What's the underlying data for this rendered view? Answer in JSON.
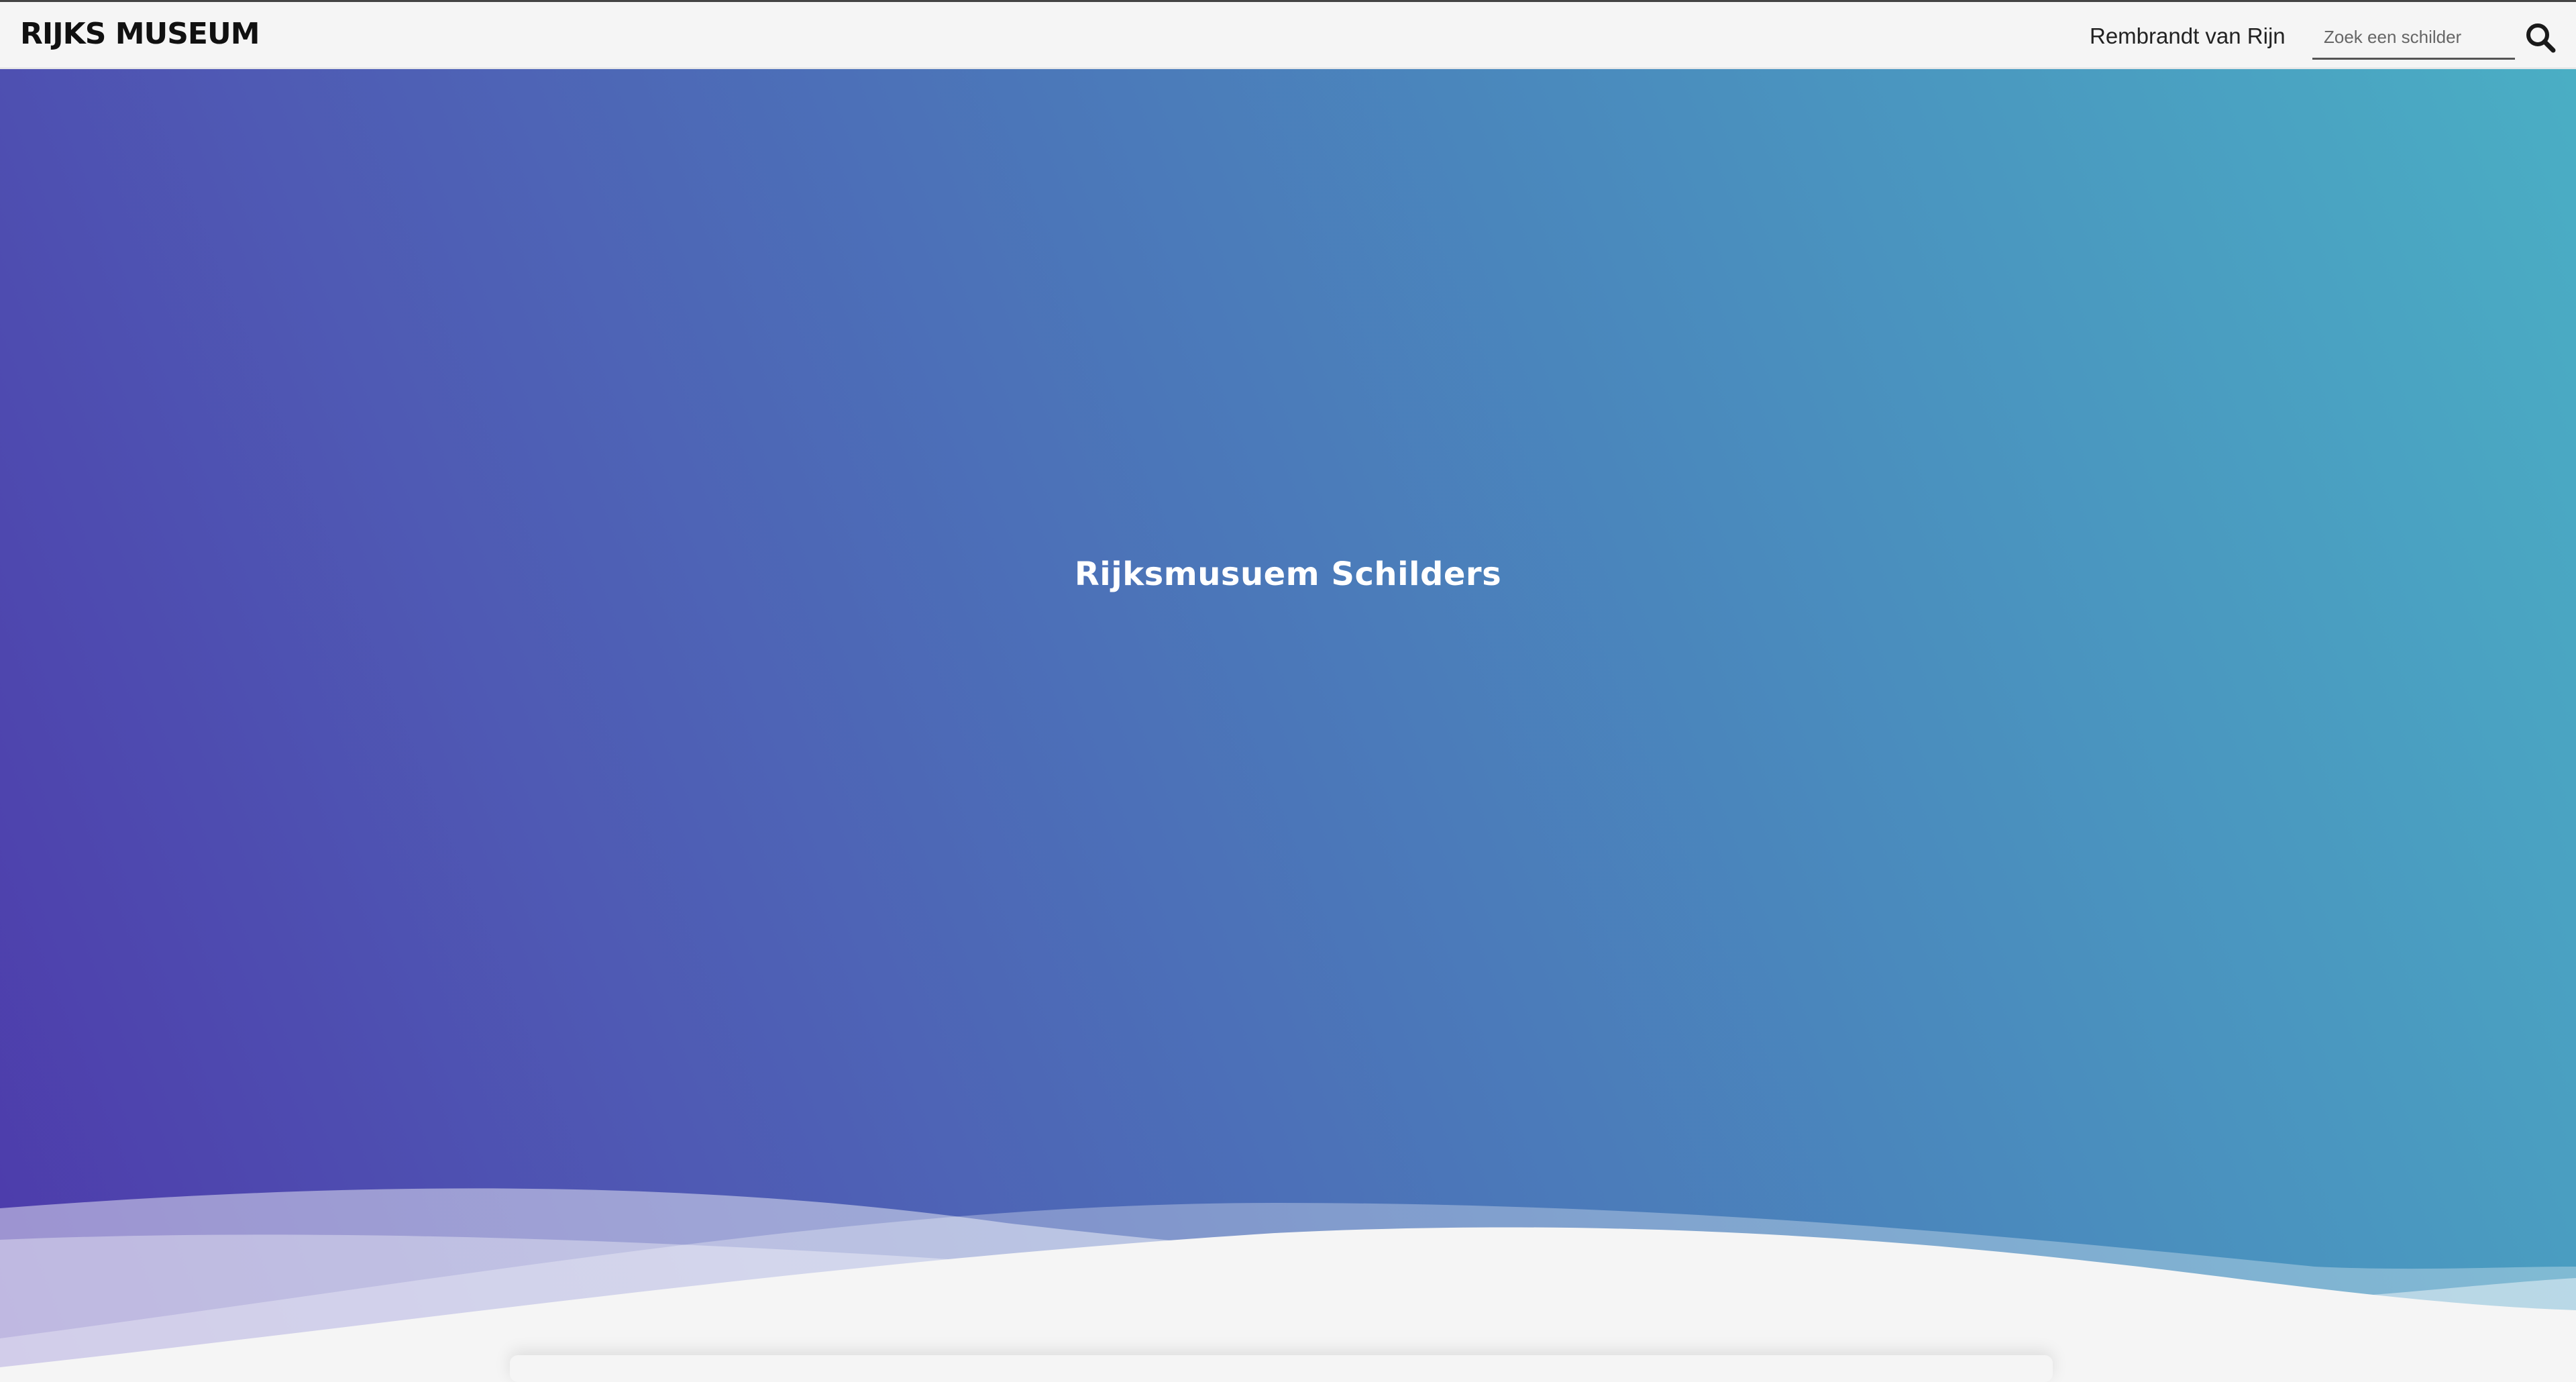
{
  "header": {
    "logo_text": "RIJKS MUSEUM",
    "nav_link": "Rembrandt van Rijn",
    "search": {
      "placeholder": "Zoek een schilder",
      "value": ""
    },
    "search_icon": "search-icon"
  },
  "hero": {
    "title": "Rijksmusuem Schilders",
    "gradient_start": "#4d3aab",
    "gradient_end": "#4aaec4"
  },
  "colors": {
    "page_background": "#f5f5f5",
    "text_dark": "#111111",
    "hero_text": "#ffffff"
  }
}
